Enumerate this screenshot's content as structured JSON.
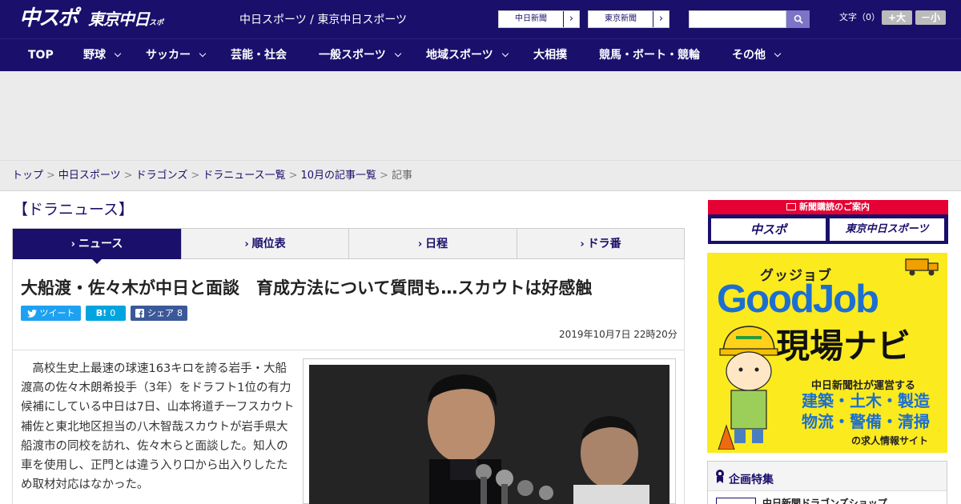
{
  "header": {
    "logo_chuspo": "中スポ",
    "logo_tokyo": "東京中日",
    "logo_tokyo_sub": "スポーツ",
    "sites": "中日スポーツ / 東京中日スポーツ",
    "np_buttons": [
      "中日新聞",
      "東京新聞"
    ],
    "search_placeholder": "",
    "font_label": "文字（0）",
    "font_larger": "+大",
    "font_smaller": "－小",
    "colors": {
      "primary": "#1a0f6b",
      "accent": "#e60033"
    }
  },
  "nav": {
    "items": [
      {
        "label": "TOP",
        "has_menu": false
      },
      {
        "label": "野球",
        "has_menu": true
      },
      {
        "label": "サッカー",
        "has_menu": true
      },
      {
        "label": "芸能・社会",
        "has_menu": false
      },
      {
        "label": "一般スポーツ",
        "has_menu": true
      },
      {
        "label": "地域スポーツ",
        "has_menu": true
      },
      {
        "label": "大相撲",
        "has_menu": false
      },
      {
        "label": "競馬・ボート・競輪",
        "has_menu": false
      },
      {
        "label": "その他",
        "has_menu": true
      }
    ]
  },
  "breadcrumb": {
    "links": [
      "トップ",
      "中日スポーツ",
      "ドラゴンズ",
      "ドラニュース一覧",
      "10月の記事一覧"
    ],
    "current": "記事"
  },
  "section": {
    "title": "【ドラニュース】"
  },
  "tabs": [
    {
      "label": "ニュース",
      "active": true
    },
    {
      "label": "順位表",
      "active": false
    },
    {
      "label": "日程",
      "active": false
    },
    {
      "label": "ドラ番",
      "active": false
    }
  ],
  "article": {
    "title": "大船渡・佐々木が中日と面談　育成方法について質問も…スカウトは好感触",
    "share": {
      "tweet": "ツイート",
      "hatena_label": "B!",
      "hatena_count": "0",
      "fb_label": "シェア",
      "fb_count": "8"
    },
    "date": "2019年10月7日 22時20分",
    "body": "　高校生史上最速の球速163キロを誇る岩手・大船渡高の佐々木朗希投手（3年）をドラフト1位の有力候補にしている中日は7日、山本将道チーフスカウト補佐と東北地区担当の八木智哉スカウトが岩手県大船渡市の同校を訪れ、佐々木らと面談した。知人の車を使用し、正門とは違う入り口から出入りしたため取材対応はなかった。"
  },
  "sidebar": {
    "subscribe_head": "新聞購読のご案内",
    "subscribe_chuspo": "中スポ",
    "subscribe_tokyo": "東京中日スポーツ",
    "goodjob": {
      "kana": "グッジョブ",
      "logo": "GoodJob",
      "navi": "現場ナビ",
      "line1": "中日新聞社が運営する",
      "line2": "建築・土木・製造",
      "line3": "物流・警備・清掃",
      "line4": "の求人情報サイト"
    },
    "feature_title": "企画特集",
    "feature_item": "中日新聞ドラゴンズショップ"
  }
}
